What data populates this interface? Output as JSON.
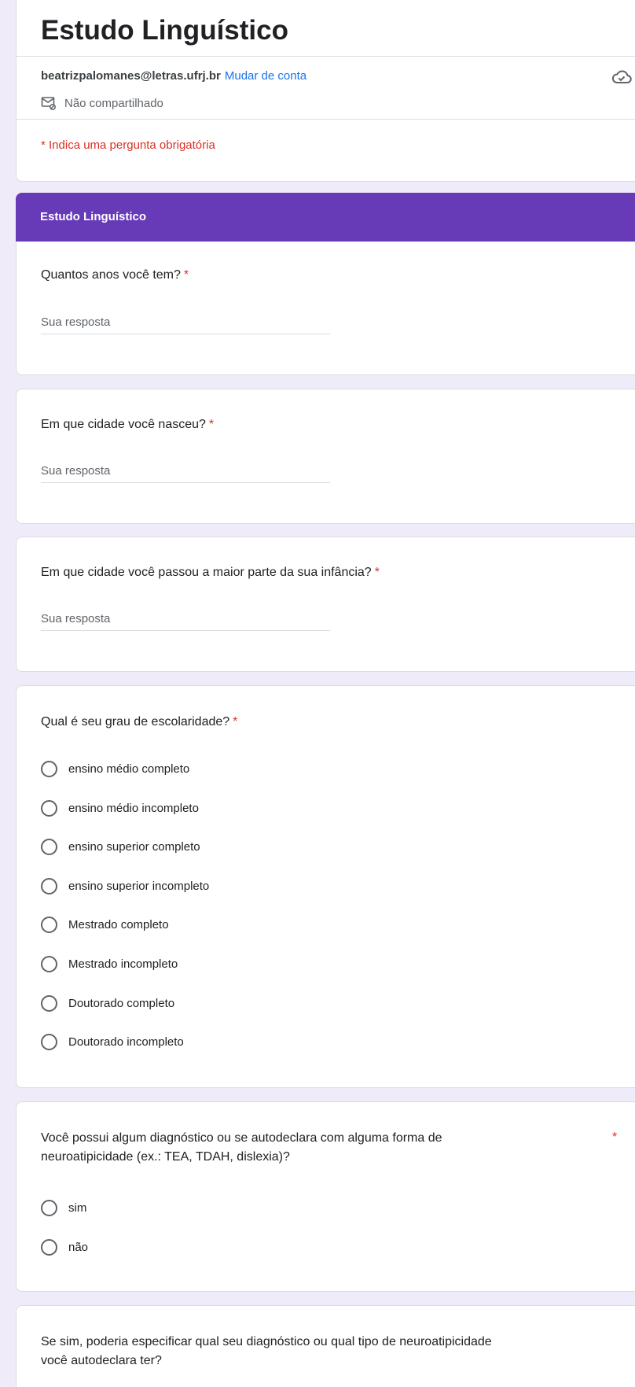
{
  "form": {
    "title": "Estudo Linguístico",
    "account_email": "beatrizpalomanes@letras.ufrj.br",
    "switch_account": "Mudar de conta",
    "not_shared": "Não compartilhado",
    "required_note": "* Indica uma pergunta obrigatória"
  },
  "section": {
    "title": "Estudo Linguístico"
  },
  "questions": [
    {
      "title": "Quantos anos você tem?",
      "required": "*",
      "placeholder": "Sua resposta"
    },
    {
      "title": "Em que cidade você nasceu?",
      "required": "*",
      "placeholder": "Sua resposta"
    },
    {
      "title": "Em que cidade você passou a maior parte da sua infância?",
      "required": "*",
      "placeholder": "Sua resposta"
    },
    {
      "title": "Qual é seu grau de escolaridade?",
      "required": "*",
      "options": [
        "ensino médio completo",
        "ensino médio incompleto",
        "ensino superior completo",
        "ensino superior incompleto",
        "Mestrado completo",
        "Mestrado incompleto",
        "Doutorado completo",
        "Doutorado incompleto"
      ]
    },
    {
      "title_line1": "Você possui algum diagnóstico ou se autodeclara com alguma forma de",
      "title_line2": "neuroatipicidade (ex.: TEA, TDAH, dislexia)?",
      "required": "*",
      "options": [
        "sim",
        "não"
      ]
    },
    {
      "title_line1": "Se sim, poderia especificar qual seu diagnóstico ou qual tipo de neuroatipicidade",
      "title_line2": "você autodeclara ter?"
    }
  ],
  "icons": {
    "cloud": "cloud-done-icon",
    "not_shared": "not-shared-icon"
  },
  "colors": {
    "accent": "#673ab7",
    "background": "#f0ebf8",
    "required": "#d93025",
    "link": "#1a73e8"
  }
}
